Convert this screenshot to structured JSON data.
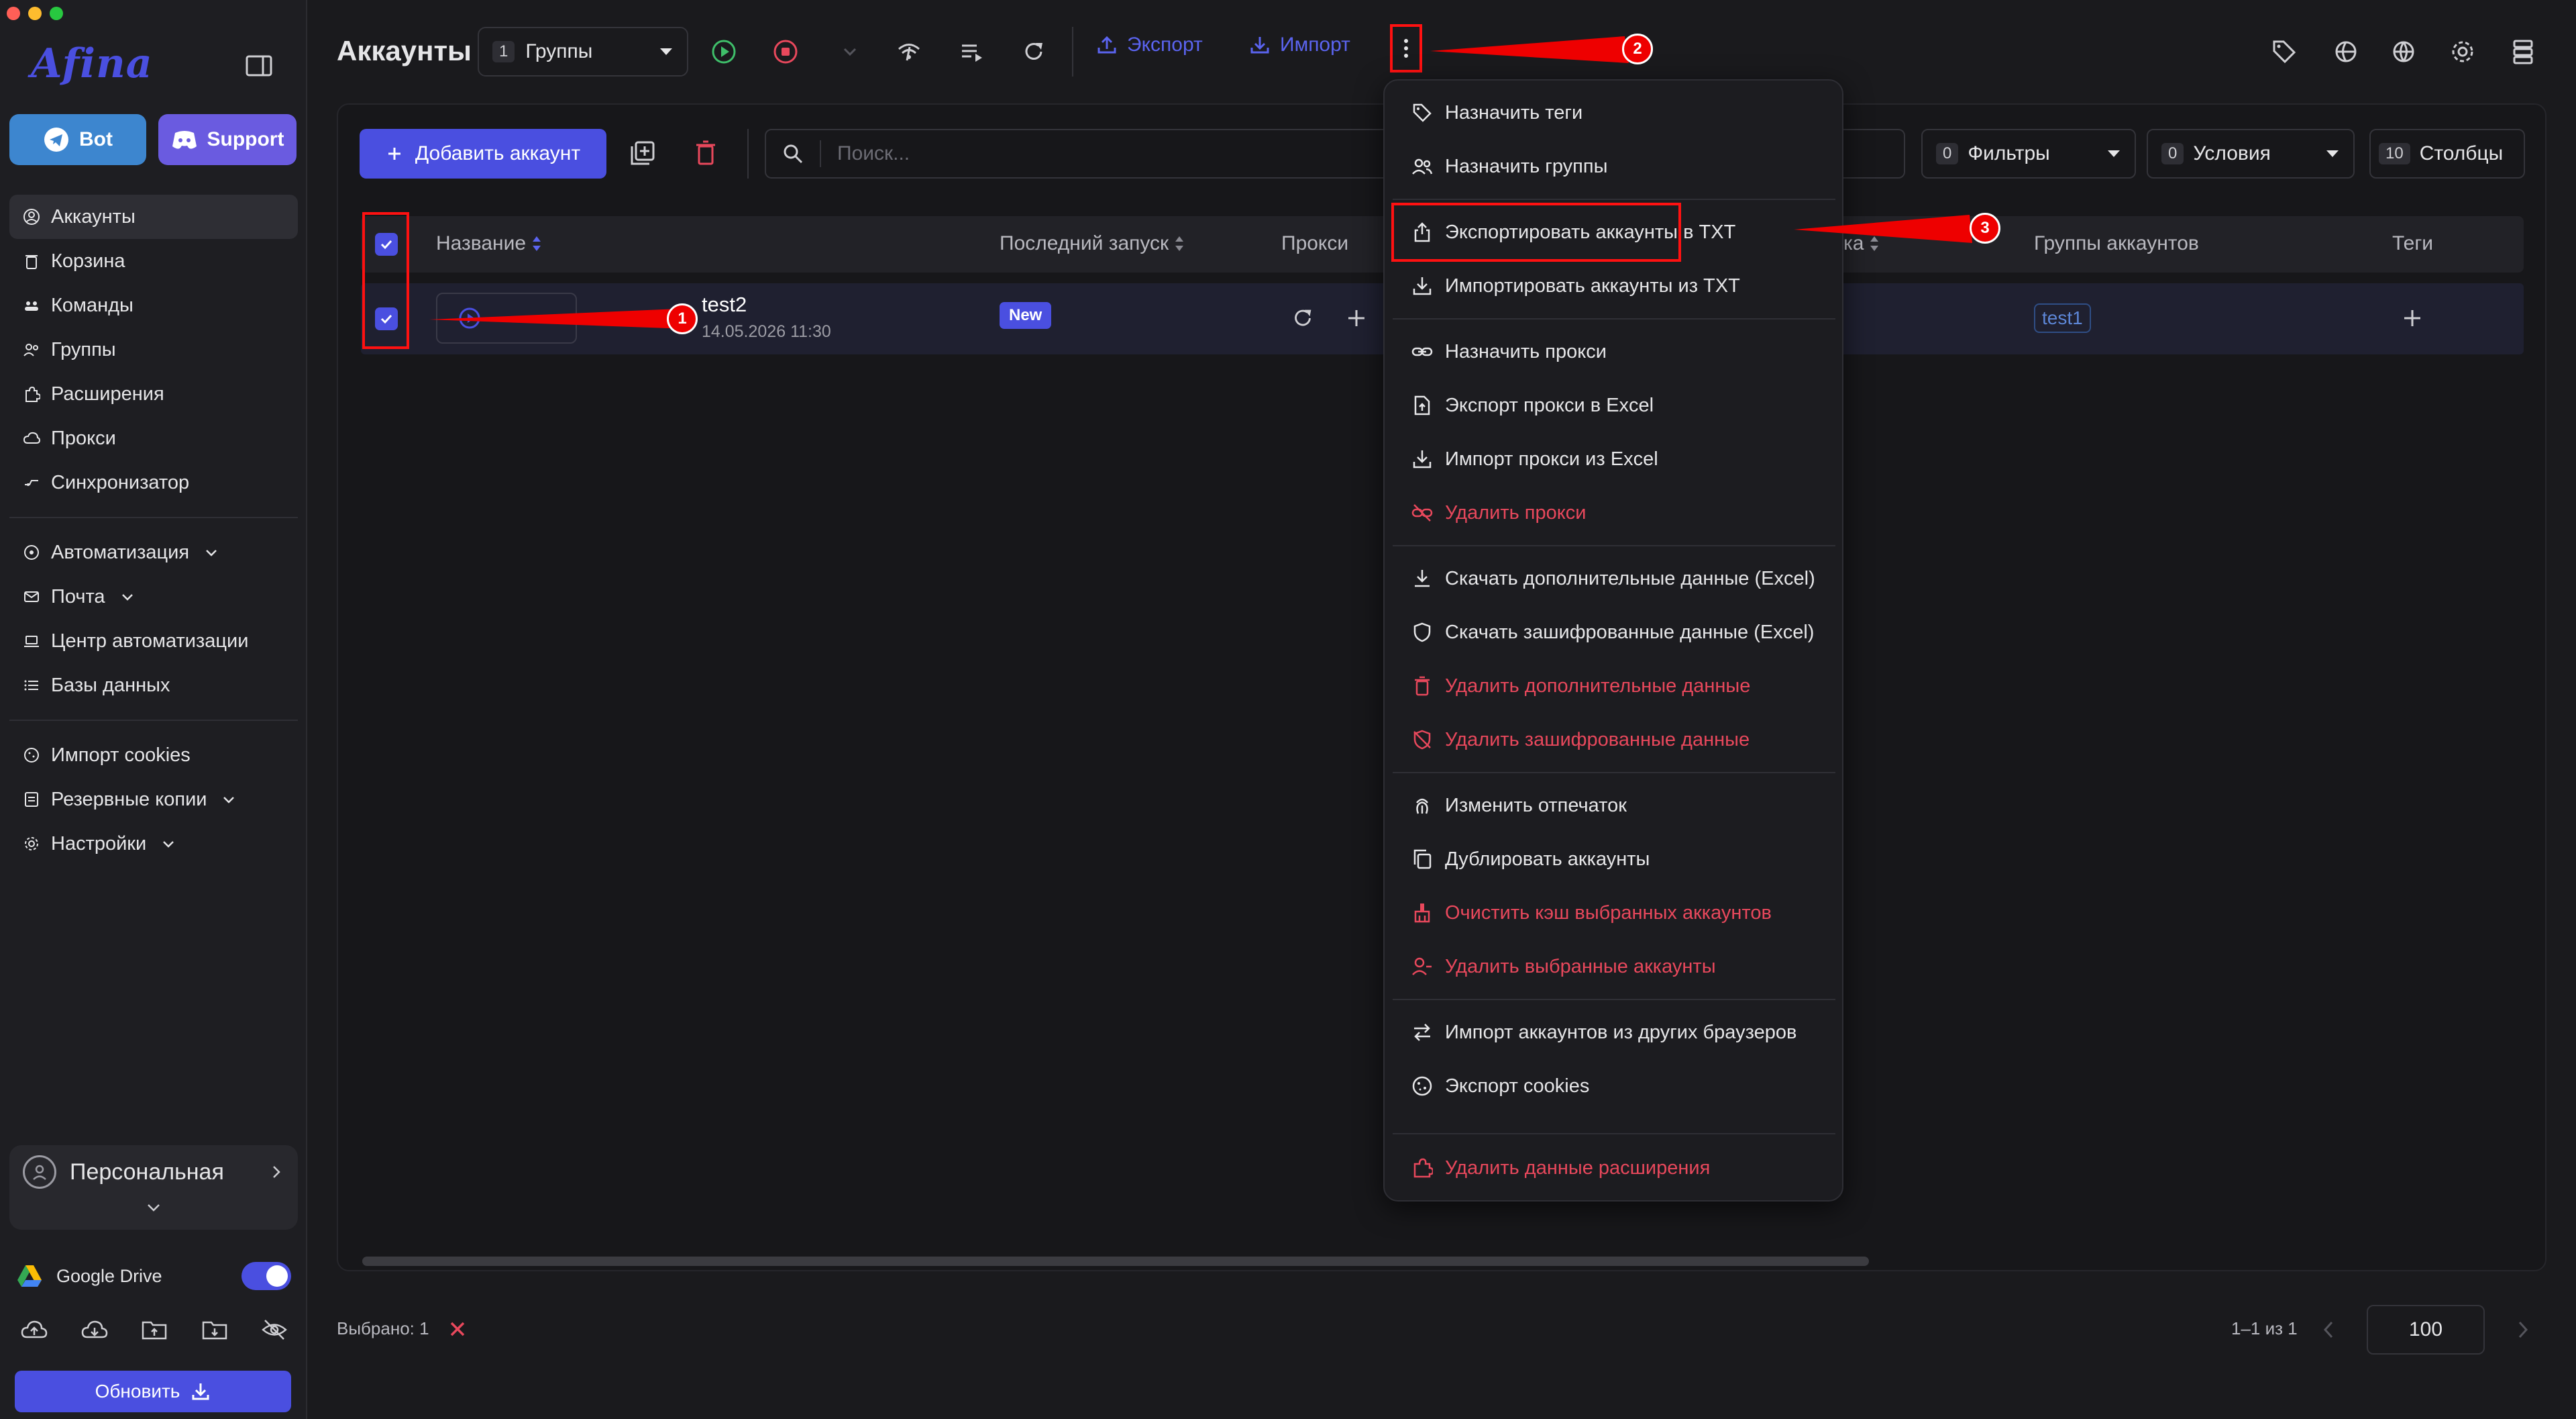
{
  "app": {
    "logo": "Afina"
  },
  "sidebar": {
    "bot_label": "Bot",
    "support_label": "Support",
    "items": [
      {
        "label": "Аккаунты",
        "icon": "user-circle-icon"
      },
      {
        "label": "Корзина",
        "icon": "trash-icon"
      },
      {
        "label": "Команды",
        "icon": "team-icon"
      },
      {
        "label": "Группы",
        "icon": "groups-icon"
      },
      {
        "label": "Расширения",
        "icon": "puzzle-icon"
      },
      {
        "label": "Прокси",
        "icon": "cloud-icon"
      },
      {
        "label": "Синхронизатор",
        "icon": "sync-icon"
      }
    ],
    "items2": [
      {
        "label": "Автоматизация",
        "icon": "automation-icon"
      },
      {
        "label": "Почта",
        "icon": "mail-icon"
      },
      {
        "label": "Центр автоматизации",
        "icon": "laptop-icon"
      },
      {
        "label": "Базы данных",
        "icon": "list-icon"
      }
    ],
    "items3": [
      {
        "label": "Импорт cookies",
        "icon": "cookie-icon"
      },
      {
        "label": "Резервные копии",
        "icon": "backup-icon"
      },
      {
        "label": "Настройки",
        "icon": "gear-icon"
      }
    ],
    "workspace": "Персональная",
    "gdrive_label": "Google Drive",
    "update_label": "Обновить"
  },
  "header": {
    "title": "Аккаунты",
    "group_count": "1",
    "group_label": "Группы",
    "export_label": "Экспорт",
    "import_label": "Импорт"
  },
  "toolbar": {
    "add_account": "Добавить аккаунт",
    "search_placeholder": "Поиск...",
    "filters_count": "0",
    "filters_label": "Фильтры",
    "conditions_count": "0",
    "conditions_label": "Условия",
    "columns_count": "10",
    "columns_label": "Столбцы"
  },
  "table": {
    "headers": {
      "name": "Название",
      "last_launch": "Последний запуск",
      "proxy": "Прокси",
      "hidden_partial": "ка",
      "account_groups": "Группы аккаунтов",
      "tags": "Теги"
    },
    "rows": [
      {
        "name": "test2",
        "date": "14.05.2026 11:30",
        "badge": "New",
        "group": "test1"
      }
    ]
  },
  "menu": {
    "items": [
      {
        "label": "Назначить теги",
        "icon": "tag-icon",
        "danger": false
      },
      {
        "label": "Назначить группы",
        "icon": "users-icon",
        "danger": false
      },
      {
        "label": "Экспортировать аккаунты в TXT",
        "icon": "export-file-icon",
        "danger": false
      },
      {
        "label": "Импортировать аккаунты из TXT",
        "icon": "download-icon",
        "danger": false
      },
      {
        "label": "Назначить прокси",
        "icon": "link-icon",
        "danger": false
      },
      {
        "label": "Экспорт прокси в Excel",
        "icon": "file-export-icon",
        "danger": false
      },
      {
        "label": "Импорт прокси из Excel",
        "icon": "download-icon",
        "danger": false
      },
      {
        "label": "Удалить прокси",
        "icon": "link-off-icon",
        "danger": true
      },
      {
        "label": "Скачать дополнительные данные (Excel)",
        "icon": "download-bar-icon",
        "danger": false
      },
      {
        "label": "Скачать зашифрованные данные (Excel)",
        "icon": "shield-icon",
        "danger": false
      },
      {
        "label": "Удалить дополнительные данные",
        "icon": "trash-icon",
        "danger": true
      },
      {
        "label": "Удалить зашифрованные данные",
        "icon": "shield-off-icon",
        "danger": true
      },
      {
        "label": "Изменить отпечаток",
        "icon": "fingerprint-icon",
        "danger": false
      },
      {
        "label": "Дублировать аккаунты",
        "icon": "copy-icon",
        "danger": false
      },
      {
        "label": "Очистить кэш выбранных аккаунтов",
        "icon": "broom-icon",
        "danger": true
      },
      {
        "label": "Удалить выбранные аккаунты",
        "icon": "user-remove-icon",
        "danger": true
      },
      {
        "label": "Импорт аккаунтов из других браузеров",
        "icon": "swap-icon",
        "danger": false
      },
      {
        "label": "Экспорт cookies",
        "icon": "cookie-icon",
        "danger": false
      },
      {
        "label": "Удалить данные расширения",
        "icon": "puzzle-icon",
        "danger": true
      }
    ]
  },
  "footer": {
    "selected_label": "Выбрано: 1",
    "pager_text": "1–1 из 1",
    "page_size": "100"
  },
  "annotations": [
    "1",
    "2",
    "3"
  ],
  "colors": {
    "accent": "#4a4fe0",
    "danger": "#e8485c",
    "annotation": "#ff1111",
    "background": "#1a1a1d"
  }
}
